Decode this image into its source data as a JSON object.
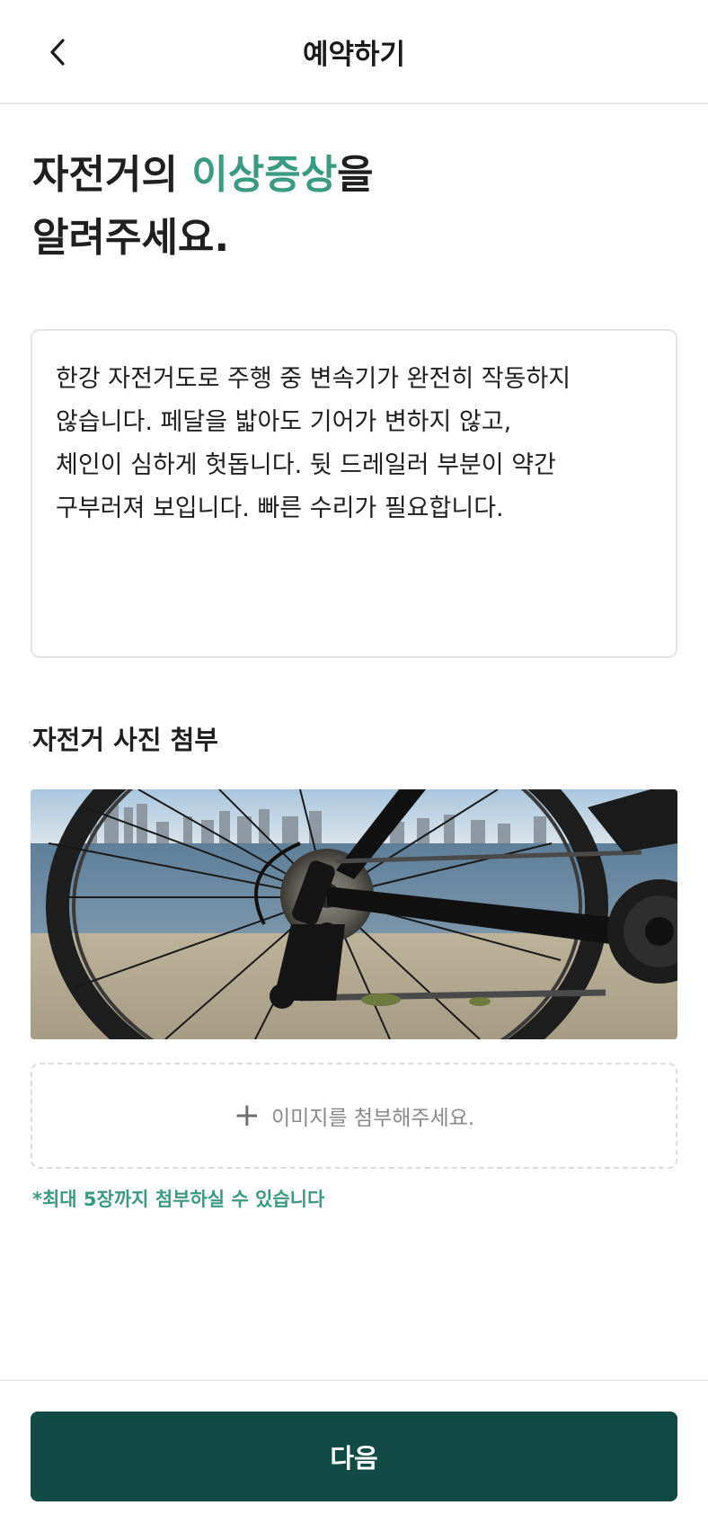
{
  "header": {
    "title": "예약하기",
    "back_icon": "chevron-left-icon"
  },
  "headline": {
    "line1_prefix": "자전거의 ",
    "line1_accent": "이상증상",
    "line1_suffix": "을",
    "line2": "알려주세요."
  },
  "symptom": {
    "text": "한강 자전거도로 주행 중 변속기가 완전히 작동하지\n않습니다. 페달을 밟아도 기어가 변하지 않고,\n체인이 심하게 헛돕니다. 뒷 드레일러 부분이 약간\n구부러져 보입니다. 빠른 수리가 필요합니다."
  },
  "photo_section": {
    "label": "자전거 사진 첨부"
  },
  "attach": {
    "plus_icon": "plus-icon",
    "plus_glyph": "+",
    "label": "이미지를 첨부해주세요.",
    "note": "*최대 5장까지 첨부하실 수 있습니다"
  },
  "footer": {
    "next_label": "다음"
  },
  "colors": {
    "accent": "#3a9a82",
    "primary_button": "#124a46"
  }
}
